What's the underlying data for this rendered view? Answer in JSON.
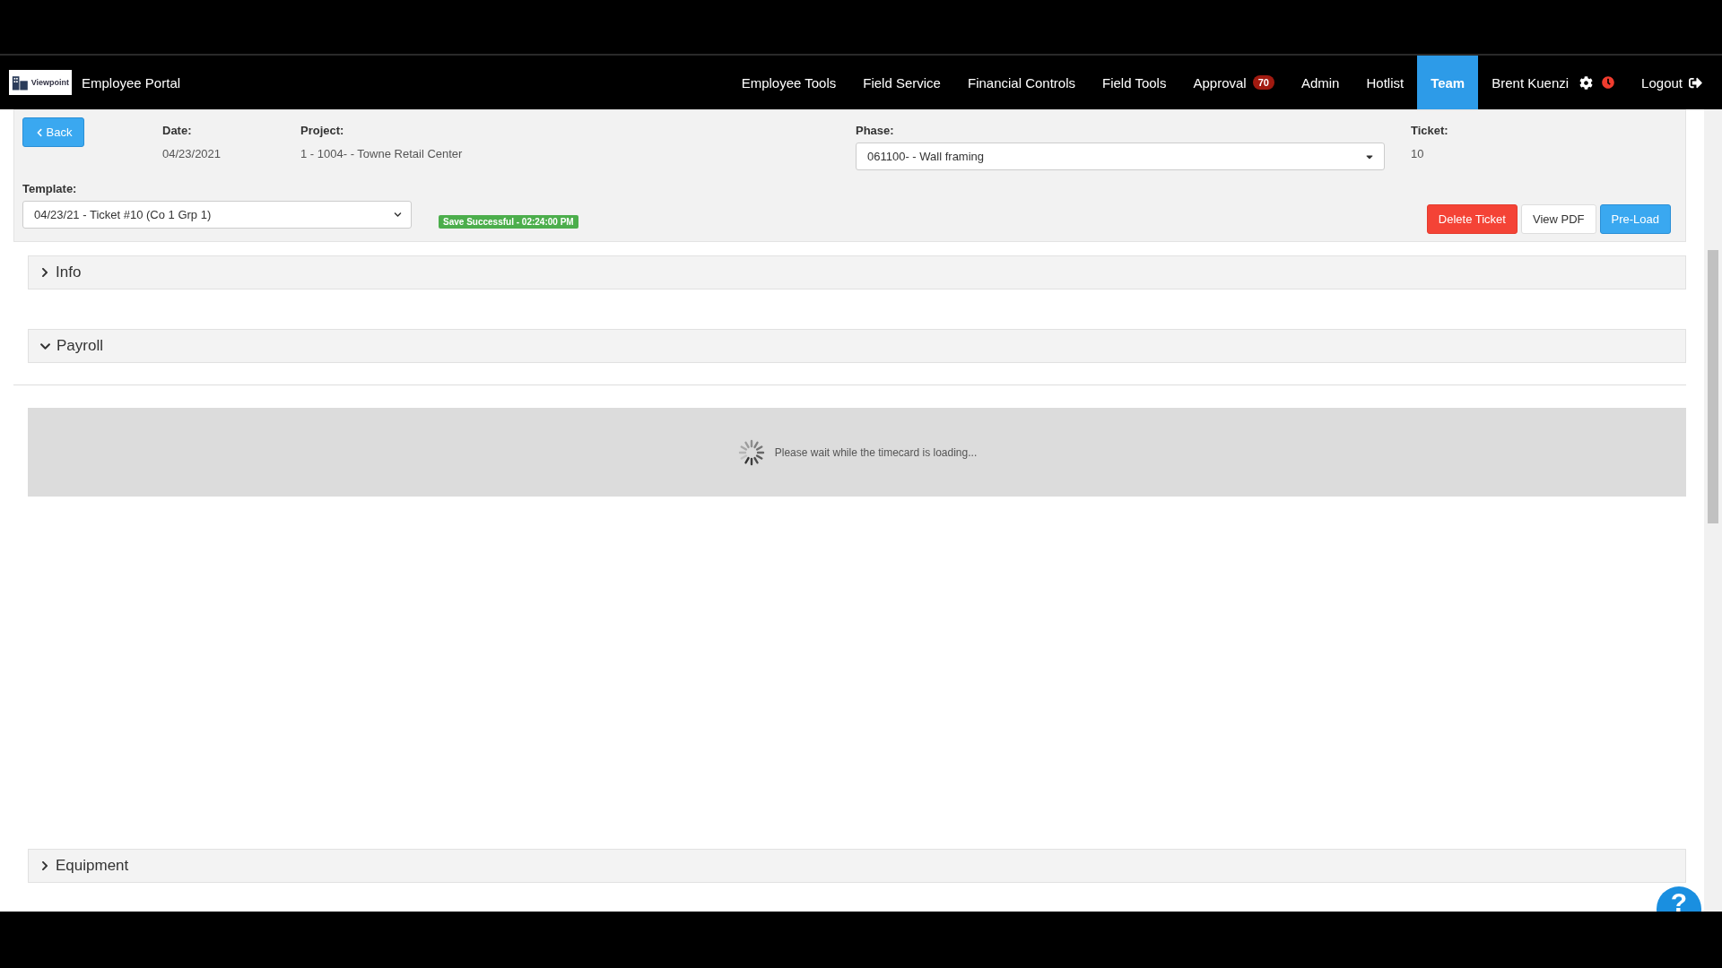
{
  "app": {
    "logo_text": "Viewpoint",
    "title": "Employee Portal"
  },
  "nav": [
    {
      "label": "Employee Tools",
      "selected": false
    },
    {
      "label": "Field Service",
      "selected": false
    },
    {
      "label": "Financial Controls",
      "selected": false
    },
    {
      "label": "Field Tools",
      "selected": false
    },
    {
      "label": "Approval",
      "selected": false,
      "badge": "70"
    },
    {
      "label": "Admin",
      "selected": false
    },
    {
      "label": "Hotlist",
      "selected": false
    },
    {
      "label": "Team",
      "selected": true
    }
  ],
  "user": {
    "name": "Brent Kuenzi"
  },
  "logout": "Logout",
  "header": {
    "back": "Back",
    "date": {
      "label": "Date:",
      "value": "04/23/2021"
    },
    "project": {
      "label": "Project:",
      "value": "1 - 1004- - Towne Retail Center"
    },
    "phase": {
      "label": "Phase:",
      "value": "061100- - Wall framing"
    },
    "ticket": {
      "label": "Ticket:",
      "value": "10"
    },
    "template": {
      "label": "Template:",
      "value": "04/23/21 - Ticket #10 (Co 1 Grp 1)"
    },
    "status": "Save Successful - 02:24:00 PM",
    "actions": [
      {
        "label": "Delete Ticket",
        "kind": "danger"
      },
      {
        "label": "View PDF",
        "kind": "default"
      },
      {
        "label": "Pre-Load",
        "kind": "primary"
      }
    ]
  },
  "sections": [
    {
      "title": "Info",
      "expanded": false
    },
    {
      "title": "Payroll",
      "expanded": true
    }
  ],
  "loading": "Please wait while the timecard is loading...",
  "footer_sections": [
    {
      "title": "Equipment",
      "expanded": false
    }
  ],
  "help": "?"
}
